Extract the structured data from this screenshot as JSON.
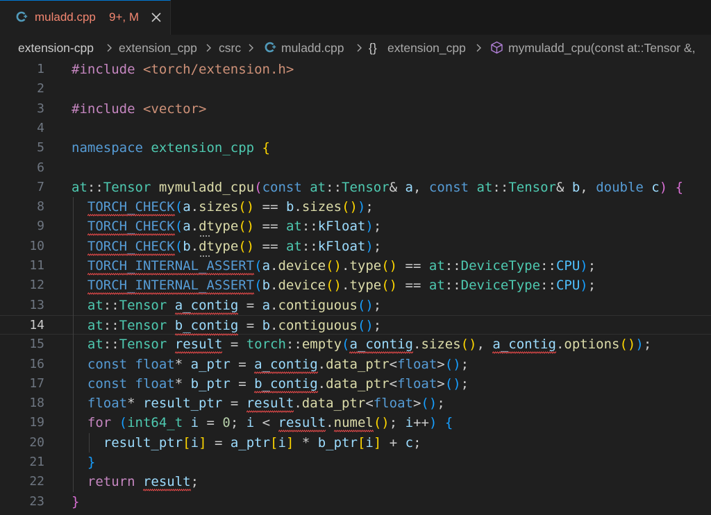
{
  "tab": {
    "file_icon": "cpp-file-icon",
    "filename": "muladd.cpp",
    "status": "9+, M",
    "close_icon": "close-icon",
    "status_color": "#f48771"
  },
  "breadcrumb": [
    {
      "label": "extension-cpp",
      "kind": "folder"
    },
    {
      "label": "extension_cpp",
      "kind": "folder"
    },
    {
      "label": "csrc",
      "kind": "folder"
    },
    {
      "label": "muladd.cpp",
      "kind": "file",
      "icon": "cpp-file-icon"
    },
    {
      "label": "extension_cpp",
      "kind": "namespace",
      "icon": "namespace-braces-icon",
      "icon_text": "{}"
    },
    {
      "label": "mymuladd_cpu(const at::Tensor &,",
      "kind": "function",
      "icon": "method-cube-icon"
    }
  ],
  "editor": {
    "active_line": 14,
    "colors": {
      "keyword": "#c586c0",
      "storage": "#569cd6",
      "type": "#4ec9b0",
      "function": "#dcdcaa",
      "variable": "#9cdcfe",
      "string": "#ce9178",
      "text": "#cccccc",
      "error_squiggle": "#f14c4c"
    },
    "lines": [
      {
        "n": "1",
        "tokens": [
          [
            "#include ",
            "#c586c0"
          ],
          [
            "<torch/extension.h>",
            "#ce9178"
          ]
        ]
      },
      {
        "n": "2",
        "tokens": []
      },
      {
        "n": "3",
        "tokens": [
          [
            "#include ",
            "#c586c0"
          ],
          [
            "<vector>",
            "#ce9178"
          ]
        ]
      },
      {
        "n": "4",
        "tokens": []
      },
      {
        "n": "5",
        "tokens": [
          [
            "namespace ",
            "#569cd6"
          ],
          [
            "extension_cpp ",
            "#4ec9b0"
          ],
          [
            "{",
            "#ffd700"
          ]
        ]
      },
      {
        "n": "6",
        "tokens": []
      },
      {
        "n": "7",
        "tokens": [
          [
            "at",
            "#4ec9b0"
          ],
          [
            "::",
            "#cccccc"
          ],
          [
            "Tensor ",
            "#4ec9b0"
          ],
          [
            "mymuladd_cpu",
            "#dcdcaa"
          ],
          [
            "(",
            "#da70d6"
          ],
          [
            "const ",
            "#569cd6"
          ],
          [
            "at",
            "#4ec9b0"
          ],
          [
            "::",
            "#cccccc"
          ],
          [
            "Tensor",
            "#4ec9b0"
          ],
          [
            "& ",
            "#cccccc"
          ],
          [
            "a",
            "#9cdcfe"
          ],
          [
            ", ",
            "#cccccc"
          ],
          [
            "const ",
            "#569cd6"
          ],
          [
            "at",
            "#4ec9b0"
          ],
          [
            "::",
            "#cccccc"
          ],
          [
            "Tensor",
            "#4ec9b0"
          ],
          [
            "& ",
            "#cccccc"
          ],
          [
            "b",
            "#9cdcfe"
          ],
          [
            ", ",
            "#cccccc"
          ],
          [
            "double ",
            "#569cd6"
          ],
          [
            "c",
            "#9cdcfe"
          ],
          [
            ") ",
            "#da70d6"
          ],
          [
            "{",
            "#da70d6"
          ]
        ]
      },
      {
        "n": "8",
        "tokens": [
          [
            "  ",
            "#cccccc"
          ],
          [
            "TORCH_CHECK",
            "#569cd6"
          ],
          [
            "(",
            "#179fff"
          ],
          [
            "a",
            "#9cdcfe"
          ],
          [
            ".",
            "#cccccc"
          ],
          [
            "sizes",
            "#dcdcaa"
          ],
          [
            "()",
            "#ffd700"
          ],
          [
            " == ",
            "#cccccc"
          ],
          [
            "b",
            "#9cdcfe"
          ],
          [
            ".",
            "#cccccc"
          ],
          [
            "sizes",
            "#dcdcaa"
          ],
          [
            "()",
            "#ffd700"
          ],
          [
            ")",
            "#179fff"
          ],
          [
            ";",
            "#cccccc"
          ]
        ]
      },
      {
        "n": "9",
        "tokens": [
          [
            "  ",
            "#cccccc"
          ],
          [
            "TORCH_CHECK",
            "#569cd6"
          ],
          [
            "(",
            "#179fff"
          ],
          [
            "a",
            "#9cdcfe"
          ],
          [
            ".",
            "#cccccc"
          ],
          [
            "dtype",
            "#dcdcaa"
          ],
          [
            "()",
            "#ffd700"
          ],
          [
            " == ",
            "#cccccc"
          ],
          [
            "at",
            "#4ec9b0"
          ],
          [
            "::",
            "#cccccc"
          ],
          [
            "kFloat",
            "#9cdcfe"
          ],
          [
            ")",
            "#179fff"
          ],
          [
            ";",
            "#cccccc"
          ]
        ]
      },
      {
        "n": "10",
        "tokens": [
          [
            "  ",
            "#cccccc"
          ],
          [
            "TORCH_CHECK",
            "#569cd6"
          ],
          [
            "(",
            "#179fff"
          ],
          [
            "b",
            "#9cdcfe"
          ],
          [
            ".",
            "#cccccc"
          ],
          [
            "dtype",
            "#dcdcaa"
          ],
          [
            "()",
            "#ffd700"
          ],
          [
            " == ",
            "#cccccc"
          ],
          [
            "at",
            "#4ec9b0"
          ],
          [
            "::",
            "#cccccc"
          ],
          [
            "kFloat",
            "#9cdcfe"
          ],
          [
            ")",
            "#179fff"
          ],
          [
            ";",
            "#cccccc"
          ]
        ]
      },
      {
        "n": "11",
        "tokens": [
          [
            "  ",
            "#cccccc"
          ],
          [
            "TORCH_INTERNAL_ASSERT",
            "#569cd6"
          ],
          [
            "(",
            "#179fff"
          ],
          [
            "a",
            "#9cdcfe"
          ],
          [
            ".",
            "#cccccc"
          ],
          [
            "device",
            "#dcdcaa"
          ],
          [
            "()",
            "#ffd700"
          ],
          [
            ".",
            "#cccccc"
          ],
          [
            "type",
            "#dcdcaa"
          ],
          [
            "()",
            "#ffd700"
          ],
          [
            " == ",
            "#cccccc"
          ],
          [
            "at",
            "#4ec9b0"
          ],
          [
            "::",
            "#cccccc"
          ],
          [
            "DeviceType",
            "#4ec9b0"
          ],
          [
            "::",
            "#cccccc"
          ],
          [
            "CPU",
            "#4fc1ff"
          ],
          [
            ")",
            "#179fff"
          ],
          [
            ";",
            "#cccccc"
          ]
        ]
      },
      {
        "n": "12",
        "tokens": [
          [
            "  ",
            "#cccccc"
          ],
          [
            "TORCH_INTERNAL_ASSERT",
            "#569cd6"
          ],
          [
            "(",
            "#179fff"
          ],
          [
            "b",
            "#9cdcfe"
          ],
          [
            ".",
            "#cccccc"
          ],
          [
            "device",
            "#dcdcaa"
          ],
          [
            "()",
            "#ffd700"
          ],
          [
            ".",
            "#cccccc"
          ],
          [
            "type",
            "#dcdcaa"
          ],
          [
            "()",
            "#ffd700"
          ],
          [
            " == ",
            "#cccccc"
          ],
          [
            "at",
            "#4ec9b0"
          ],
          [
            "::",
            "#cccccc"
          ],
          [
            "DeviceType",
            "#4ec9b0"
          ],
          [
            "::",
            "#cccccc"
          ],
          [
            "CPU",
            "#4fc1ff"
          ],
          [
            ")",
            "#179fff"
          ],
          [
            ";",
            "#cccccc"
          ]
        ]
      },
      {
        "n": "13",
        "tokens": [
          [
            "  ",
            "#cccccc"
          ],
          [
            "at",
            "#4ec9b0"
          ],
          [
            "::",
            "#cccccc"
          ],
          [
            "Tensor ",
            "#4ec9b0"
          ],
          [
            "a_contig",
            "#9cdcfe"
          ],
          [
            " = ",
            "#cccccc"
          ],
          [
            "a",
            "#9cdcfe"
          ],
          [
            ".",
            "#cccccc"
          ],
          [
            "contiguous",
            "#dcdcaa"
          ],
          [
            "()",
            "#179fff"
          ],
          [
            ";",
            "#cccccc"
          ]
        ]
      },
      {
        "n": "14",
        "tokens": [
          [
            "  ",
            "#cccccc"
          ],
          [
            "at",
            "#4ec9b0"
          ],
          [
            "::",
            "#cccccc"
          ],
          [
            "Tensor ",
            "#4ec9b0"
          ],
          [
            "b_contig",
            "#9cdcfe"
          ],
          [
            " = ",
            "#cccccc"
          ],
          [
            "b",
            "#9cdcfe"
          ],
          [
            ".",
            "#cccccc"
          ],
          [
            "contiguous",
            "#dcdcaa"
          ],
          [
            "()",
            "#179fff"
          ],
          [
            ";",
            "#cccccc"
          ]
        ]
      },
      {
        "n": "15",
        "tokens": [
          [
            "  ",
            "#cccccc"
          ],
          [
            "at",
            "#4ec9b0"
          ],
          [
            "::",
            "#cccccc"
          ],
          [
            "Tensor ",
            "#4ec9b0"
          ],
          [
            "result",
            "#9cdcfe"
          ],
          [
            " = ",
            "#cccccc"
          ],
          [
            "torch",
            "#4ec9b0"
          ],
          [
            "::",
            "#cccccc"
          ],
          [
            "empty",
            "#dcdcaa"
          ],
          [
            "(",
            "#179fff"
          ],
          [
            "a_contig",
            "#9cdcfe"
          ],
          [
            ".",
            "#cccccc"
          ],
          [
            "sizes",
            "#dcdcaa"
          ],
          [
            "()",
            "#ffd700"
          ],
          [
            ", ",
            "#cccccc"
          ],
          [
            "a_contig",
            "#9cdcfe"
          ],
          [
            ".",
            "#cccccc"
          ],
          [
            "options",
            "#dcdcaa"
          ],
          [
            "()",
            "#ffd700"
          ],
          [
            ")",
            "#179fff"
          ],
          [
            ";",
            "#cccccc"
          ]
        ]
      },
      {
        "n": "16",
        "tokens": [
          [
            "  ",
            "#cccccc"
          ],
          [
            "const ",
            "#569cd6"
          ],
          [
            "float",
            "#569cd6"
          ],
          [
            "* ",
            "#cccccc"
          ],
          [
            "a_ptr",
            "#9cdcfe"
          ],
          [
            " = ",
            "#cccccc"
          ],
          [
            "a_contig",
            "#9cdcfe"
          ],
          [
            ".",
            "#cccccc"
          ],
          [
            "data_ptr",
            "#dcdcaa"
          ],
          [
            "<",
            "#cccccc"
          ],
          [
            "float",
            "#569cd6"
          ],
          [
            ">",
            "#cccccc"
          ],
          [
            "()",
            "#179fff"
          ],
          [
            ";",
            "#cccccc"
          ]
        ]
      },
      {
        "n": "17",
        "tokens": [
          [
            "  ",
            "#cccccc"
          ],
          [
            "const ",
            "#569cd6"
          ],
          [
            "float",
            "#569cd6"
          ],
          [
            "* ",
            "#cccccc"
          ],
          [
            "b_ptr",
            "#9cdcfe"
          ],
          [
            " = ",
            "#cccccc"
          ],
          [
            "b_contig",
            "#9cdcfe"
          ],
          [
            ".",
            "#cccccc"
          ],
          [
            "data_ptr",
            "#dcdcaa"
          ],
          [
            "<",
            "#cccccc"
          ],
          [
            "float",
            "#569cd6"
          ],
          [
            ">",
            "#cccccc"
          ],
          [
            "()",
            "#179fff"
          ],
          [
            ";",
            "#cccccc"
          ]
        ]
      },
      {
        "n": "18",
        "tokens": [
          [
            "  ",
            "#cccccc"
          ],
          [
            "float",
            "#569cd6"
          ],
          [
            "* ",
            "#cccccc"
          ],
          [
            "result_ptr",
            "#9cdcfe"
          ],
          [
            " = ",
            "#cccccc"
          ],
          [
            "result",
            "#9cdcfe"
          ],
          [
            ".",
            "#cccccc"
          ],
          [
            "data_ptr",
            "#dcdcaa"
          ],
          [
            "<",
            "#cccccc"
          ],
          [
            "float",
            "#569cd6"
          ],
          [
            ">",
            "#cccccc"
          ],
          [
            "()",
            "#179fff"
          ],
          [
            ";",
            "#cccccc"
          ]
        ]
      },
      {
        "n": "19",
        "tokens": [
          [
            "  ",
            "#cccccc"
          ],
          [
            "for ",
            "#c586c0"
          ],
          [
            "(",
            "#179fff"
          ],
          [
            "int64_t ",
            "#4ec9b0"
          ],
          [
            "i",
            "#9cdcfe"
          ],
          [
            " = ",
            "#cccccc"
          ],
          [
            "0",
            "#b5cea8"
          ],
          [
            "; ",
            "#cccccc"
          ],
          [
            "i",
            "#9cdcfe"
          ],
          [
            " < ",
            "#cccccc"
          ],
          [
            "result",
            "#9cdcfe"
          ],
          [
            ".",
            "#cccccc"
          ],
          [
            "numel",
            "#dcdcaa"
          ],
          [
            "()",
            "#ffd700"
          ],
          [
            "; ",
            "#cccccc"
          ],
          [
            "i",
            "#9cdcfe"
          ],
          [
            "++",
            "#cccccc"
          ],
          [
            ") ",
            "#179fff"
          ],
          [
            "{",
            "#179fff"
          ]
        ]
      },
      {
        "n": "20",
        "tokens": [
          [
            "    ",
            "#cccccc"
          ],
          [
            "result_ptr",
            "#9cdcfe"
          ],
          [
            "[",
            "#ffd700"
          ],
          [
            "i",
            "#9cdcfe"
          ],
          [
            "]",
            "#ffd700"
          ],
          [
            " = ",
            "#cccccc"
          ],
          [
            "a_ptr",
            "#9cdcfe"
          ],
          [
            "[",
            "#ffd700"
          ],
          [
            "i",
            "#9cdcfe"
          ],
          [
            "]",
            "#ffd700"
          ],
          [
            " * ",
            "#cccccc"
          ],
          [
            "b_ptr",
            "#9cdcfe"
          ],
          [
            "[",
            "#ffd700"
          ],
          [
            "i",
            "#9cdcfe"
          ],
          [
            "]",
            "#ffd700"
          ],
          [
            " + ",
            "#cccccc"
          ],
          [
            "c",
            "#9cdcfe"
          ],
          [
            ";",
            "#cccccc"
          ]
        ]
      },
      {
        "n": "21",
        "tokens": [
          [
            "  ",
            "#cccccc"
          ],
          [
            "}",
            "#179fff"
          ]
        ]
      },
      {
        "n": "22",
        "tokens": [
          [
            "  ",
            "#cccccc"
          ],
          [
            "return ",
            "#c586c0"
          ],
          [
            "result",
            "#9cdcfe"
          ],
          [
            ";",
            "#cccccc"
          ]
        ]
      },
      {
        "n": "23",
        "tokens": [
          [
            "}",
            "#da70d6"
          ]
        ]
      }
    ]
  }
}
